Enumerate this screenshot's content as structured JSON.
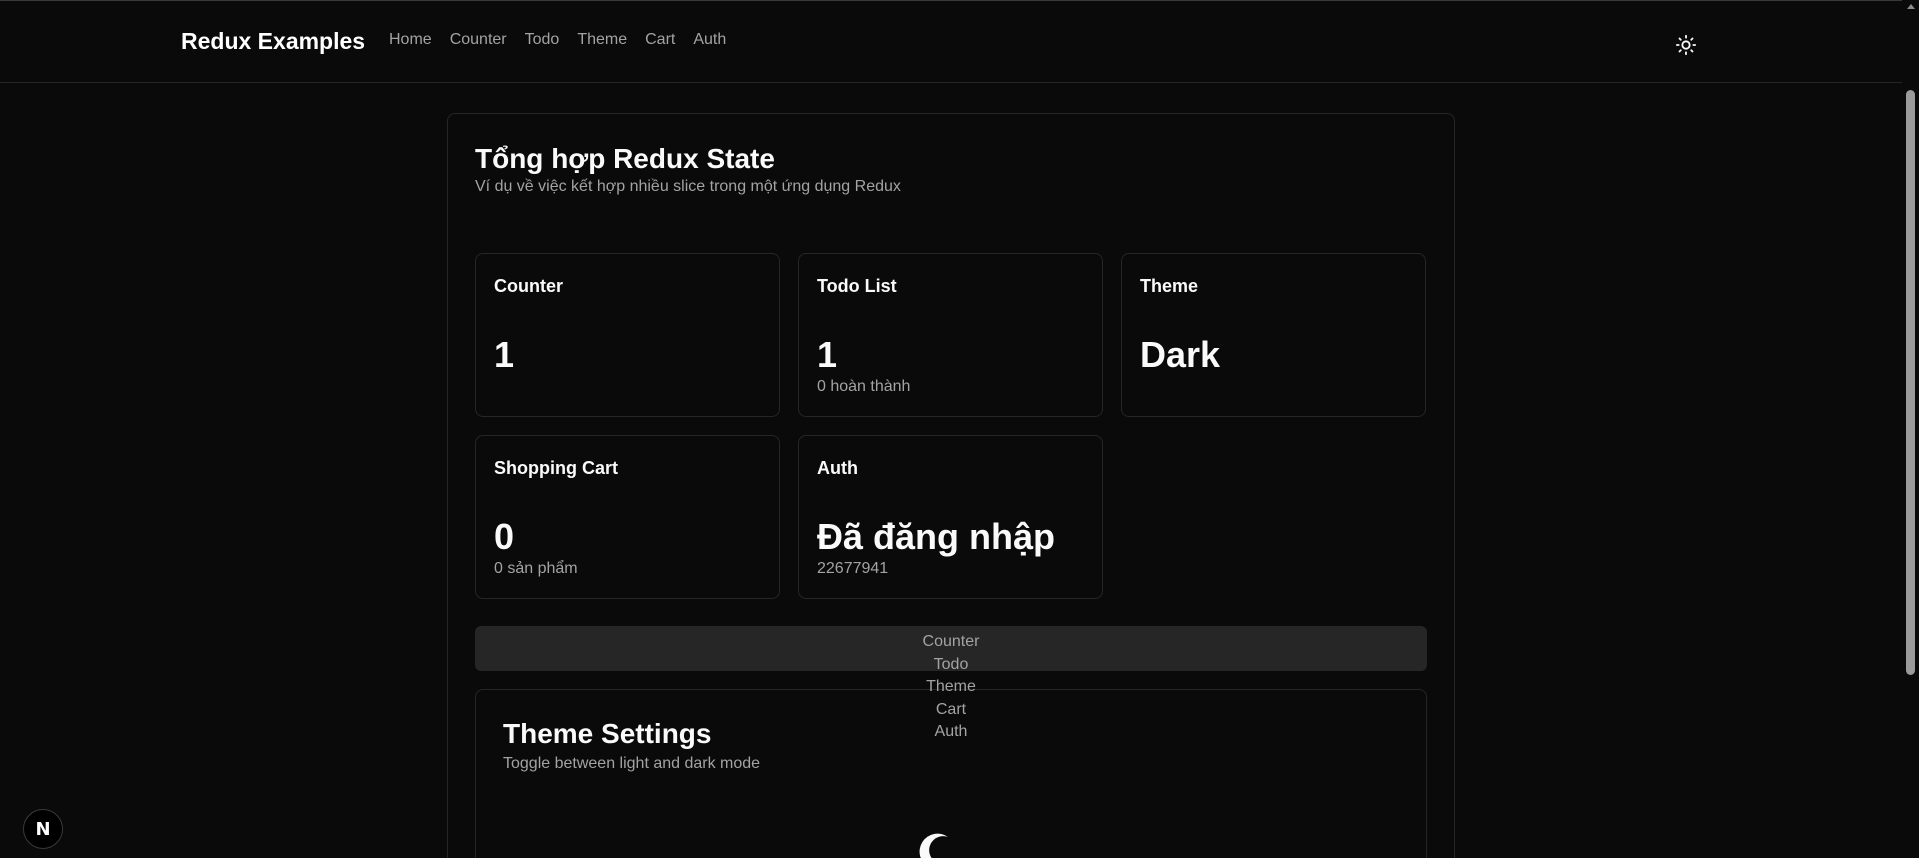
{
  "header": {
    "brand": "Redux Examples",
    "nav": [
      "Home",
      "Counter",
      "Todo",
      "Theme",
      "Cart",
      "Auth"
    ],
    "theme_toggle_icon": "sun-icon"
  },
  "main": {
    "title": "Tổng hợp Redux State",
    "subtitle": "Ví dụ về việc kết hợp nhiều slice trong một ứng dụng Redux",
    "cards": {
      "counter": {
        "title": "Counter",
        "value": "1",
        "sub": ""
      },
      "todo": {
        "title": "Todo List",
        "value": "1",
        "sub": "0 hoàn thành"
      },
      "theme": {
        "title": "Theme",
        "value": "Dark",
        "sub": ""
      },
      "cart": {
        "title": "Shopping Cart",
        "value": "0",
        "sub": "0 sản phẩm"
      },
      "auth": {
        "title": "Auth",
        "value": "Đã đăng nhập",
        "sub": "22677941"
      }
    },
    "tabs": [
      "Counter",
      "Todo",
      "Theme",
      "Cart",
      "Auth"
    ]
  },
  "panel": {
    "title": "Theme Settings",
    "subtitle": "Toggle between light and dark mode",
    "icon": "moon-icon"
  },
  "badge": {
    "label": "N"
  },
  "colors": {
    "background": "#0a0a0a",
    "border": "#262626",
    "muted": "#a3a3a3",
    "tab_bg": "#262626"
  }
}
